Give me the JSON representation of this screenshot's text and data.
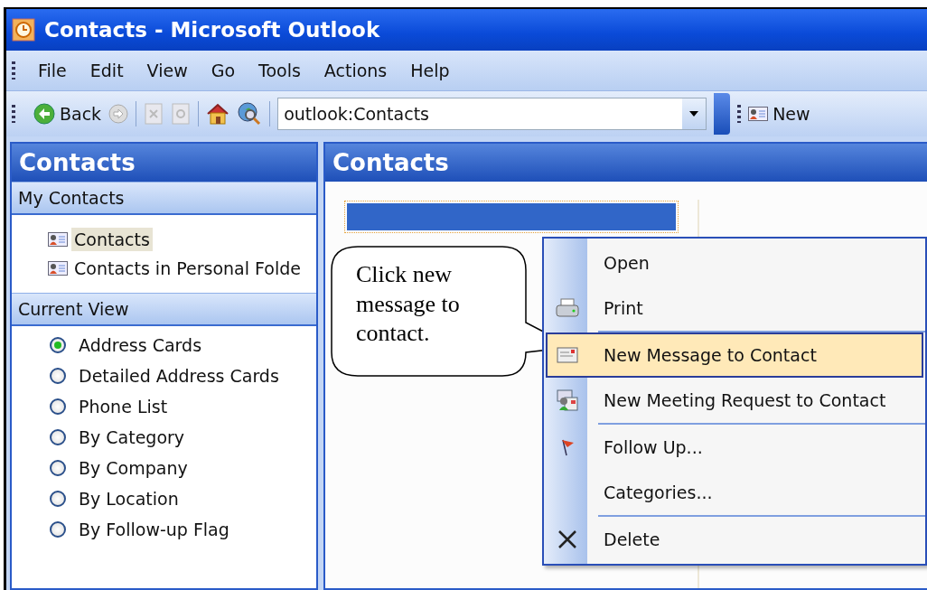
{
  "window": {
    "title": "Contacts - Microsoft Outlook"
  },
  "menu_bar": [
    "File",
    "Edit",
    "View",
    "Go",
    "Tools",
    "Actions",
    "Help"
  ],
  "toolbar": {
    "back": "Back",
    "address": "outlook:Contacts",
    "new": "New"
  },
  "navigation_pane": {
    "title": "Contacts",
    "my_contacts": {
      "header": "My Contacts",
      "items": [
        {
          "label": "Contacts",
          "selected": true
        },
        {
          "label": "Contacts in Personal Folde",
          "selected": false
        }
      ]
    },
    "current_view": {
      "header": "Current View",
      "options": [
        {
          "label": "Address Cards",
          "selected": true
        },
        {
          "label": "Detailed Address Cards",
          "selected": false
        },
        {
          "label": "Phone List",
          "selected": false
        },
        {
          "label": "By Category",
          "selected": false
        },
        {
          "label": "By Company",
          "selected": false
        },
        {
          "label": "By Location",
          "selected": false
        },
        {
          "label": "By Follow-up Flag",
          "selected": false
        }
      ]
    }
  },
  "content_pane": {
    "title": "Contacts"
  },
  "context_menu": [
    {
      "kind": "item",
      "label": "Open",
      "selected": false
    },
    {
      "kind": "item",
      "label": "Print",
      "selected": false
    },
    {
      "kind": "separator"
    },
    {
      "kind": "item",
      "label": "New Message to Contact",
      "selected": true
    },
    {
      "kind": "item",
      "label": "New Meeting Request to Contact",
      "selected": false
    },
    {
      "kind": "separator"
    },
    {
      "kind": "item",
      "label": "Follow Up...",
      "selected": false
    },
    {
      "kind": "item",
      "label": "Categories...",
      "selected": false
    },
    {
      "kind": "separator"
    },
    {
      "kind": "item",
      "label": "Delete",
      "selected": false
    }
  ],
  "callout": {
    "text": "Click new message to contact."
  }
}
